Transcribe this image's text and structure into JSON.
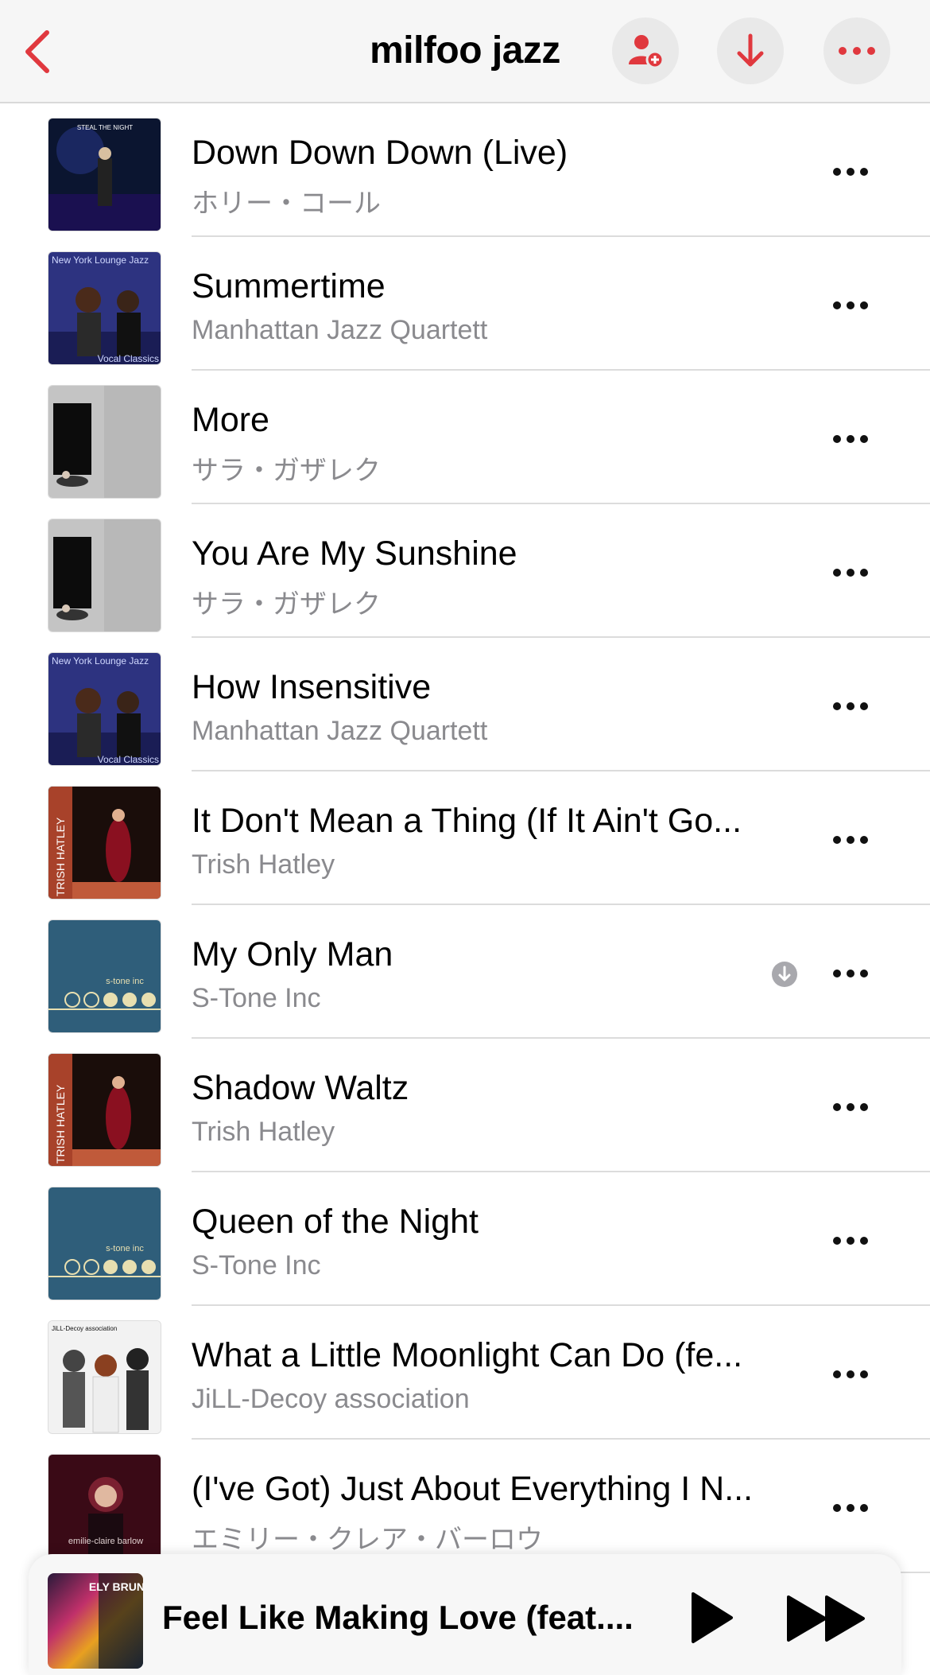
{
  "header": {
    "title": "milfoo jazz",
    "back_icon": "chevron-left-icon",
    "add_person_icon": "person-add-icon",
    "download_icon": "arrow-down-icon",
    "more_icon": "ellipsis-icon",
    "accent_color": "#e0383e"
  },
  "tracks": [
    {
      "title": "Down Down Down (Live)",
      "artist": "ホリー・コール",
      "art": "dark-navy-concert"
    },
    {
      "title": "Summertime",
      "artist": "Manhattan Jazz Quartett",
      "art": "new-york-lounge"
    },
    {
      "title": "More",
      "artist": "サラ・ガザレク",
      "art": "grey-door"
    },
    {
      "title": "You Are My Sunshine",
      "artist": "サラ・ガザレク",
      "art": "grey-door"
    },
    {
      "title": "How Insensitive",
      "artist": "Manhattan Jazz Quartett",
      "art": "new-york-lounge"
    },
    {
      "title": "It Don't Mean a Thing (If It Ain't Go...",
      "artist": "Trish Hatley",
      "art": "trish-hatley"
    },
    {
      "title": "My Only Man",
      "artist": "S-Tone Inc",
      "art": "s-tone",
      "downloading": true
    },
    {
      "title": "Shadow Waltz",
      "artist": "Trish Hatley",
      "art": "trish-hatley"
    },
    {
      "title": "Queen of the Night",
      "artist": "S-Tone Inc",
      "art": "s-tone"
    },
    {
      "title": "What a Little Moonlight Can Do (fe...",
      "artist": "JiLL-Decoy association",
      "art": "jill-decoy"
    },
    {
      "title": "(I've Got) Just About Everything I N...",
      "artist": "エミリー・クレア・バーロウ",
      "art": "emilie-claire"
    }
  ],
  "art_text": {
    "dark-navy-concert": "STEAL THE NIGHT",
    "new-york-lounge": "New York Lounge Jazz",
    "new-york-lounge-sub": "Vocal Classics",
    "trish-hatley": "TRISH HATLEY",
    "s-tone": "s-tone inc",
    "jill-decoy": "JiLL-Decoy association",
    "emilie-claire": "emilie-claire barlow"
  },
  "now_playing": {
    "title": "Feel Like Making Love (feat....",
    "art_text": "ELY BRUNA",
    "play_icon": "play-icon",
    "forward_icon": "fast-forward-icon"
  }
}
